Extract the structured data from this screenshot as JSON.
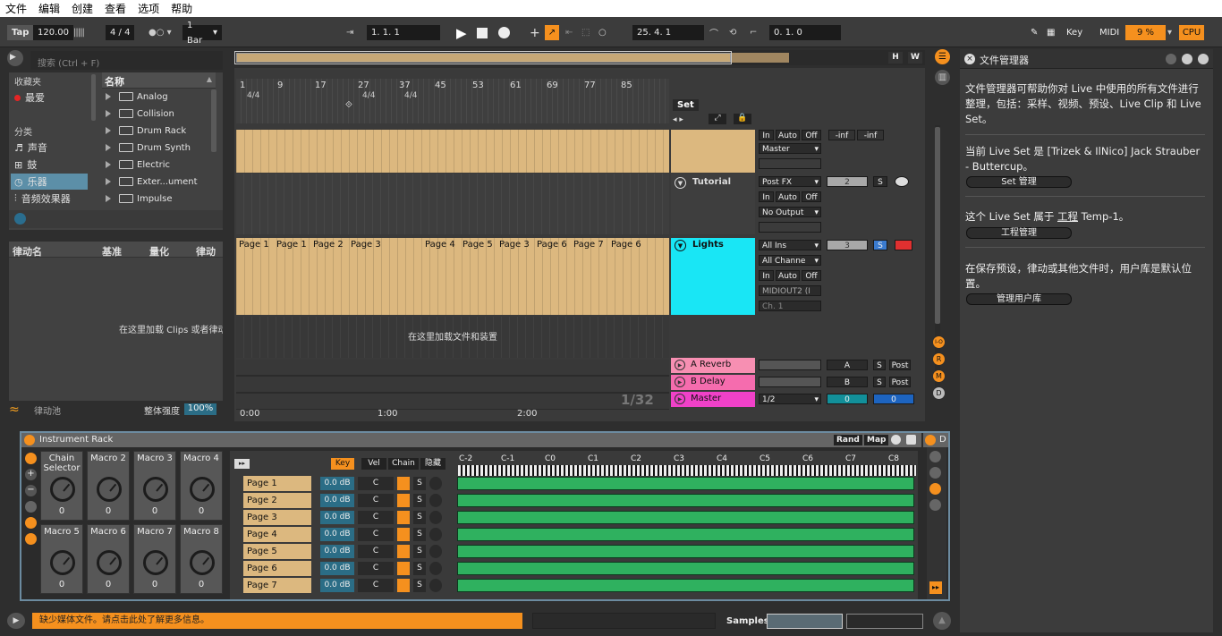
{
  "menu": [
    "文件",
    "编辑",
    "创建",
    "查看",
    "选项",
    "帮助"
  ],
  "control": {
    "tap": "Tap",
    "tempo": "120.00",
    "meter": "4 / 4",
    "quant": "1 Bar",
    "position": "1.   1.   1",
    "loop_start": "25.   4.   1",
    "loop_len": "0.   1.   0",
    "key": "Key",
    "midi": "MIDI",
    "cpu_pct": "9 %",
    "cpu": "CPU",
    "h": "H",
    "w": "W"
  },
  "browser": {
    "search_placeholder": "搜索 (Ctrl + F)",
    "collections_title": "收藏夹",
    "favorite": "最爱",
    "categories_title": "分类",
    "categories": [
      "声音",
      "鼓",
      "乐器",
      "音频效果器"
    ],
    "name_header": "名称",
    "items": [
      "Analog",
      "Collision",
      "Drum Rack",
      "Drum Synth",
      "Electric",
      "Exter...ument",
      "Impulse"
    ]
  },
  "groove": {
    "headers": [
      "律动名",
      "基准",
      "量化",
      "律动"
    ],
    "empty_hint": "在这里加载 Clips 或者律动",
    "pool": "律动池",
    "amount_label": "整体强度",
    "amount_value": "100%"
  },
  "arrangement": {
    "ruler": [
      "1",
      "9",
      "17",
      "27",
      "37",
      "45",
      "53",
      "61",
      "69",
      "77",
      "85"
    ],
    "sig_markers": [
      "4/4",
      "4/4",
      "4/4"
    ],
    "clip_labels": [
      "Page 1",
      "Page 1",
      "Page 2",
      "Page 3",
      "Page 4",
      "Page 5",
      "Page 3",
      "Page 6",
      "Page 7",
      "Page 6"
    ],
    "drop_hint": "在这里加载文件和装置",
    "time_ruler": [
      "0:00",
      "1:00",
      "2:00"
    ],
    "zoom": "1/32"
  },
  "mixer": {
    "set_label": "Set",
    "tracks": [
      {
        "name": "",
        "in": "In",
        "auto": "Auto",
        "off": "Off",
        "out": "Master",
        "vol": "-inf",
        "vol2": "-inf"
      },
      {
        "name": "Tutorial",
        "route": "Post FX",
        "in": "In",
        "auto": "Auto",
        "off": "Off",
        "out": "No Output",
        "num": "2",
        "s": "S"
      },
      {
        "name": "Lights",
        "route": "All Ins",
        "chan": "All Channe",
        "in": "In",
        "auto": "Auto",
        "off": "Off",
        "out": "MIDIOUT2 (I",
        "ch": "Ch. 1",
        "num": "3",
        "s": "S"
      }
    ],
    "returns": [
      {
        "name": "A Reverb",
        "letter": "A",
        "s": "S",
        "post": "Post"
      },
      {
        "name": "B Delay",
        "letter": "B",
        "s": "S",
        "post": "Post"
      },
      {
        "name": "Master",
        "route": "1/2",
        "v1": "0",
        "v2": "0"
      }
    ],
    "side_letters": [
      "I-O",
      "R",
      "M",
      "D"
    ]
  },
  "rack": {
    "title": "Instrument Rack",
    "rand": "Rand",
    "map": "Map",
    "macros": [
      "Chain Selector",
      "Macro 2",
      "Macro 3",
      "Macro 4",
      "Macro 5",
      "Macro 6",
      "Macro 7",
      "Macro 8"
    ],
    "macro_values": [
      "0",
      "0",
      "0",
      "0",
      "0",
      "0",
      "0",
      "0"
    ],
    "chain_tabs": [
      "Key",
      "Vel",
      "Chain",
      "隐藏"
    ],
    "chains": [
      "Page 1",
      "Page 2",
      "Page 3",
      "Page 4",
      "Page 5",
      "Page 6",
      "Page 7"
    ],
    "chain_vol": "0.0 dB",
    "chain_pan": "C",
    "chain_solo": "S",
    "notes": [
      "C-2",
      "C-1",
      "C0",
      "C1",
      "C2",
      "C3",
      "C4",
      "C5",
      "C6",
      "C7",
      "C8"
    ],
    "next_device": "D"
  },
  "info": {
    "title": "文件管理器",
    "p1": "文件管理器可帮助你对 Live 中使用的所有文件进行整理，包括：采样、视频、预设、Live Clip 和 Live Set。",
    "p2": "当前 Live Set 是 [Trizek & IlNico] Jack Strauber - Buttercup。",
    "btn1": "Set 管理",
    "p3a": "这个 Live Set 属于",
    "p3link": "工程",
    "p3b": "Temp-1。",
    "btn2": "工程管理",
    "p4": "在保存预设，律动或其他文件时，用户库是默认位置。",
    "btn3": "管理用户库"
  },
  "status": {
    "message": "缺少媒体文件。请点击此处了解更多信息。",
    "samples": "Samples"
  },
  "colors": {
    "accent": "#f5901e",
    "clip": "#dcb87f",
    "lights": "#19e6f5",
    "reverb": "#f78fb2",
    "master": "#f041c8",
    "chain_zone": "#2fb15f"
  }
}
